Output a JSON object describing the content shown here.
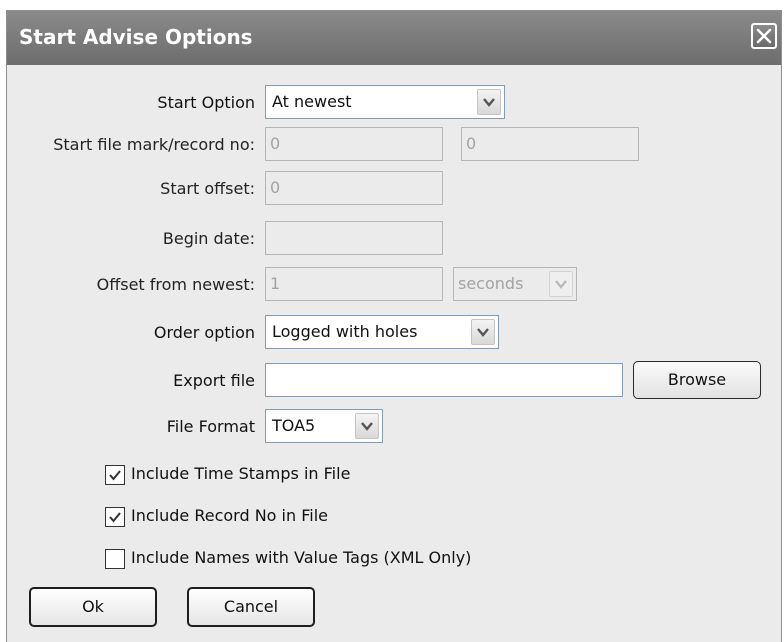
{
  "window": {
    "title": "Start Advise Options",
    "close_icon": "close-icon"
  },
  "form": {
    "start_option": {
      "label": "Start Option",
      "value": "At newest"
    },
    "start_file_mark": {
      "label": "Start file mark/record no:",
      "value1": "0",
      "value2": "0"
    },
    "start_offset": {
      "label": "Start offset:",
      "value": "0"
    },
    "begin_date": {
      "label": "Begin date:",
      "value": ""
    },
    "offset_from_newest": {
      "label": "Offset from newest:",
      "value": "1",
      "unit": "seconds"
    },
    "order_option": {
      "label": "Order option",
      "value": "Logged with holes"
    },
    "export_file": {
      "label": "Export file",
      "value": "",
      "browse_label": "Browse"
    },
    "file_format": {
      "label": "File Format",
      "value": "TOA5"
    }
  },
  "checkboxes": [
    {
      "label": "Include Time Stamps in File",
      "checked": true
    },
    {
      "label": "Include Record No in File",
      "checked": true
    },
    {
      "label": "Include Names with Value Tags (XML Only)",
      "checked": false
    }
  ],
  "buttons": {
    "ok": "Ok",
    "cancel": "Cancel"
  },
  "colors": {
    "titlebar": "#7a7a7a",
    "dialog_bg": "#ebebeb",
    "field_border": "#7f9db9"
  }
}
